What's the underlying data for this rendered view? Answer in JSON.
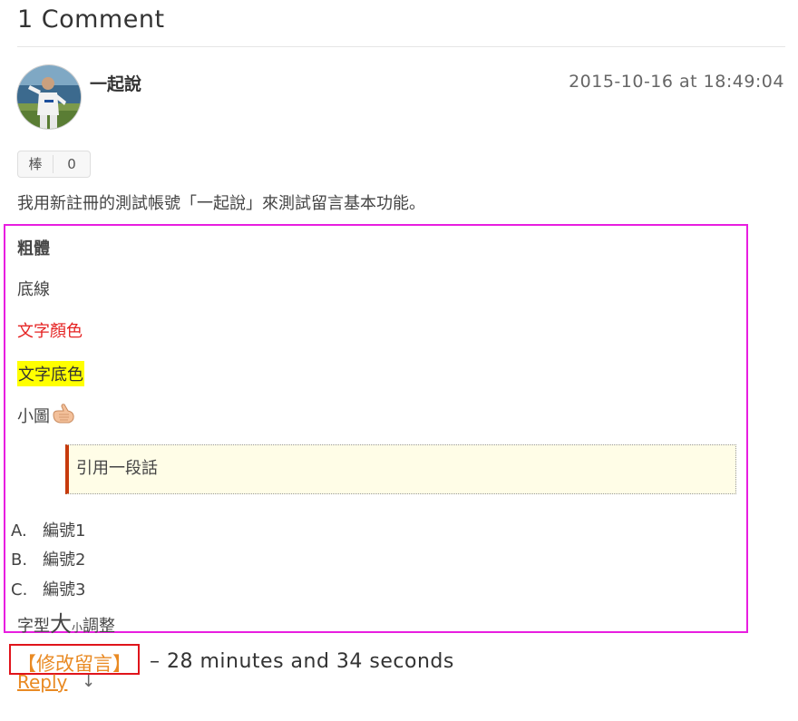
{
  "comments": {
    "heading": "1 Comment"
  },
  "comment": {
    "author": "一起說",
    "date": "2015-10-16 at 18:49:04",
    "like": {
      "label": "棒",
      "count": "0"
    },
    "intro": "我用新註冊的測試帳號「一起說」來測試留言基本功能。",
    "body": {
      "bold": "粗體",
      "underline": "底線",
      "colored": "文字顏色",
      "colored_hex": "#e52222",
      "highlight": "文字底色",
      "highlight_hex": "#ffff00",
      "small_image": "小圖",
      "quote": "引用一段話",
      "list": [
        {
          "marker": "A.",
          "text": "編號1"
        },
        {
          "marker": "B.",
          "text": "編號2"
        },
        {
          "marker": "C.",
          "text": "編號3"
        }
      ],
      "font_size": {
        "prefix": "字型",
        "big": "大",
        "small": "小",
        "suffix": "調整"
      }
    },
    "actions": {
      "edit": "【修改留言】",
      "elapsed": "– 28 minutes and 34 seconds",
      "reply": "Reply",
      "reply_arrow": "↓"
    }
  },
  "colors": {
    "accent": "#e98a23",
    "highlight_frame": "#e81ee0",
    "edit_frame": "#e0141b",
    "quote_bar": "#c63a0c"
  }
}
